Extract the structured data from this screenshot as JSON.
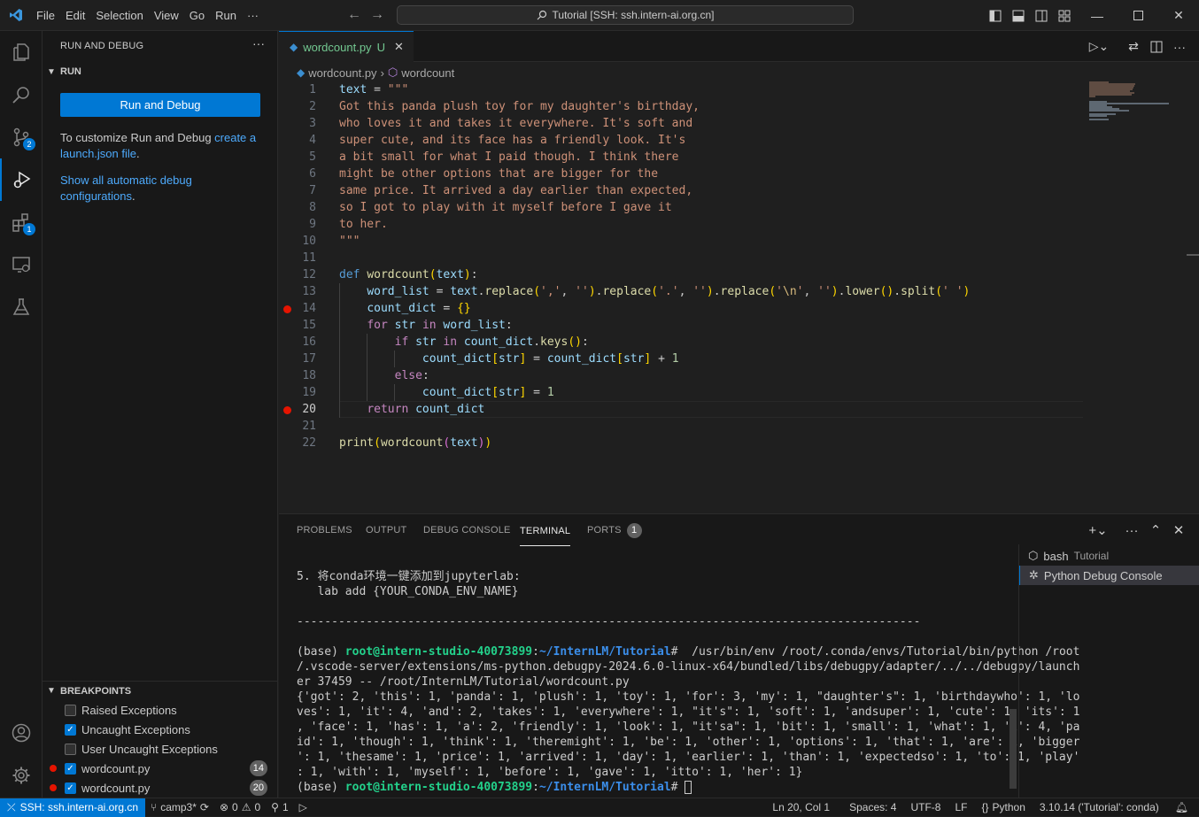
{
  "titlebar": {
    "menu": [
      "File",
      "Edit",
      "Selection",
      "View",
      "Go",
      "Run",
      "···"
    ],
    "search": "Tutorial [SSH: ssh.intern-ai.org.cn]"
  },
  "activity": {
    "scm_badge": "2",
    "ext_badge": "1"
  },
  "sidebar": {
    "title": "RUN AND DEBUG",
    "run_section": "RUN",
    "run_button": "Run and Debug",
    "customize_text": "To customize Run and Debug ",
    "customize_link1": "create a",
    "customize_link2": "launch.json file",
    "customize_end": ".",
    "show_link1": "Show all automatic debug",
    "show_link2": "configurations",
    "show_end": ".",
    "breakpoints_title": "BREAKPOINTS",
    "breakpoints": [
      {
        "label": "Raised Exceptions",
        "checked": false
      },
      {
        "label": "Uncaught Exceptions",
        "checked": true
      },
      {
        "label": "User Uncaught Exceptions",
        "checked": false
      },
      {
        "label": "wordcount.py",
        "checked": true,
        "line": "14"
      },
      {
        "label": "wordcount.py",
        "checked": true,
        "line": "20"
      }
    ]
  },
  "editor": {
    "tab_label": "wordcount.py",
    "tab_status": "U",
    "breadcrumb_file": "wordcount.py",
    "breadcrumb_symbol": "wordcount",
    "line_numbers": [
      "1",
      "2",
      "3",
      "4",
      "5",
      "6",
      "7",
      "8",
      "9",
      "10",
      "11",
      "12",
      "13",
      "14",
      "15",
      "16",
      "17",
      "18",
      "19",
      "20",
      "21",
      "22"
    ],
    "current_line": "20"
  },
  "panel": {
    "tabs": [
      "PROBLEMS",
      "OUTPUT",
      "DEBUG CONSOLE",
      "TERMINAL",
      "PORTS"
    ],
    "ports_count": "1",
    "terminals": [
      {
        "name": "bash",
        "sub": "Tutorial"
      },
      {
        "name": "Python Debug Console",
        "sub": ""
      }
    ],
    "lines": [
      "5. 将conda环境一键添加到jupyterlab:",
      "   lab add {YOUR_CONDA_ENV_NAME}",
      "",
      "------------------------------------------------------------------------------------------",
      "",
      "",
      "/.vscode-server/extensions/ms-python.debugpy-2024.6.0-linux-x64/bundled/libs/debugpy/adapter/../../debugpy/launch",
      "er 37459 -- /root/InternLM/Tutorial/wordcount.py",
      "{'got': 2, 'this': 1, 'panda': 1, 'plush': 1, 'toy': 1, 'for': 3, 'my': 1, \"daughter's\": 1, 'birthdaywho': 1, 'lo",
      "ves': 1, 'it': 4, 'and': 2, 'takes': 1, 'everywhere': 1, \"it's\": 1, 'soft': 1, 'andsuper': 1, 'cute': 1, 'its': 1",
      ", 'face': 1, 'has': 1, 'a': 2, 'friendly': 1, 'look': 1, \"it'sa\": 1, 'bit': 1, 'small': 1, 'what': 1, 'i': 4, 'pa",
      "id': 1, 'though': 1, 'think': 1, 'theremight': 1, 'be': 1, 'other': 1, 'options': 1, 'that': 1, 'are': 1, 'bigger",
      "': 1, 'thesame': 1, 'price': 1, 'arrived': 1, 'day': 1, 'earlier': 1, 'than': 1, 'expectedso': 1, 'to': 1, 'play'",
      ": 1, 'with': 1, 'myself': 1, 'before': 1, 'gave': 1, 'itto': 1, 'her': 1}"
    ],
    "prompt_base": "(base) ",
    "prompt_user": "root@intern-studio-40073899",
    "prompt_colon": ":",
    "prompt_path": "~/InternLM/Tutorial",
    "prompt_hash": "# ",
    "cmd": " /usr/bin/env /root/.conda/envs/Tutorial/bin/python /root"
  },
  "status": {
    "remote": "SSH: ssh.intern-ai.org.cn",
    "branch": "camp3*",
    "errors": "0",
    "warnings": "0",
    "ports": "1",
    "position": "Ln 20, Col 1",
    "spaces": "Spaces: 4",
    "encoding": "UTF-8",
    "eol": "LF",
    "language": "Python",
    "interpreter": "3.10.14 ('Tutorial': conda)"
  },
  "colors": {
    "accent": "#0078d4",
    "breakpoint": "#e51400",
    "untracked": "#73c991"
  }
}
